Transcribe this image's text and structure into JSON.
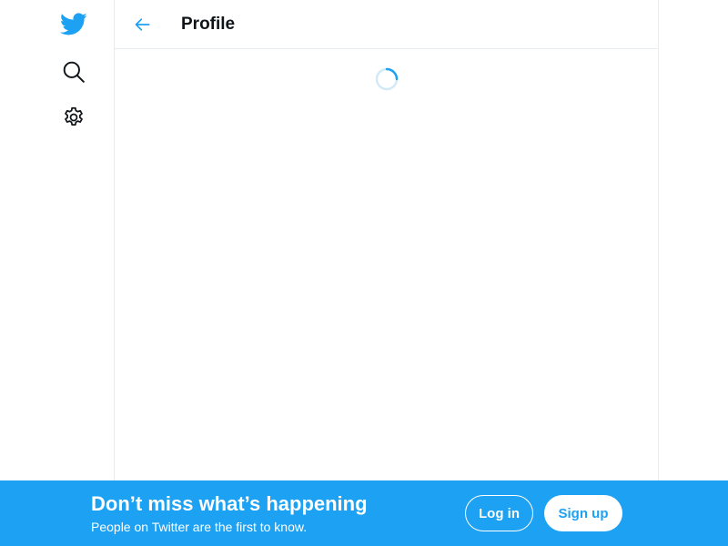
{
  "nav": {
    "logo_icon": "twitter-bird-icon",
    "search_icon": "search-icon",
    "settings_icon": "gear-icon"
  },
  "header": {
    "back_icon": "arrow-left-icon",
    "title": "Profile"
  },
  "content": {
    "state": "loading",
    "spinner_icon": "loading-spinner-icon"
  },
  "banner": {
    "headline": "Don’t miss what’s happening",
    "subtext": "People on Twitter are the first to know.",
    "login_label": "Log in",
    "signup_label": "Sign up"
  },
  "colors": {
    "brand": "#1da1f2",
    "text_primary": "#0f1419",
    "border": "#e6ecf0",
    "background": "#ffffff"
  }
}
